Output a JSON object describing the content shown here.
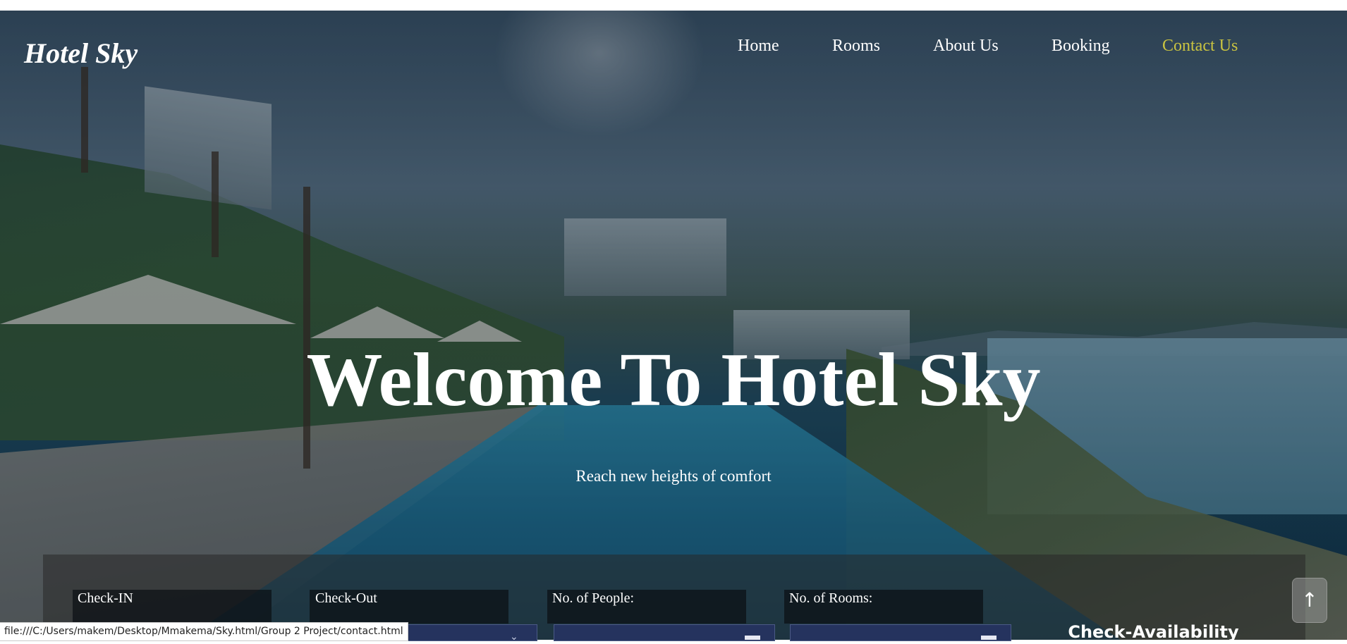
{
  "header": {
    "logo": "Hotel Sky",
    "nav": [
      {
        "label": "Home",
        "active": false
      },
      {
        "label": "Rooms",
        "active": false
      },
      {
        "label": "About Us",
        "active": false
      },
      {
        "label": "Booking",
        "active": false
      },
      {
        "label": "Contact Us",
        "active": true
      }
    ]
  },
  "hero": {
    "title": "Welcome To Hotel Sky",
    "subtitle": "Reach new heights of comfort"
  },
  "booking": {
    "fields": [
      {
        "label": "Check-IN"
      },
      {
        "label": "Check-Out"
      },
      {
        "label": "No. of People:"
      },
      {
        "label": "No. of Rooms:"
      }
    ],
    "button": "Check-Availability"
  },
  "scroll_top": {
    "glyph": "↑",
    "icon": "arrow-up-icon"
  },
  "status_bar": {
    "url": "file:///C:/Users/makem/Desktop/Mmakema/Sky.html/Group 2 Project/contact.html"
  },
  "colors": {
    "nav_active": "#c9c341",
    "nav_text": "#ffffff",
    "select_bg": "#25335e",
    "panel_bg": "rgba(40,40,40,0.55)"
  }
}
